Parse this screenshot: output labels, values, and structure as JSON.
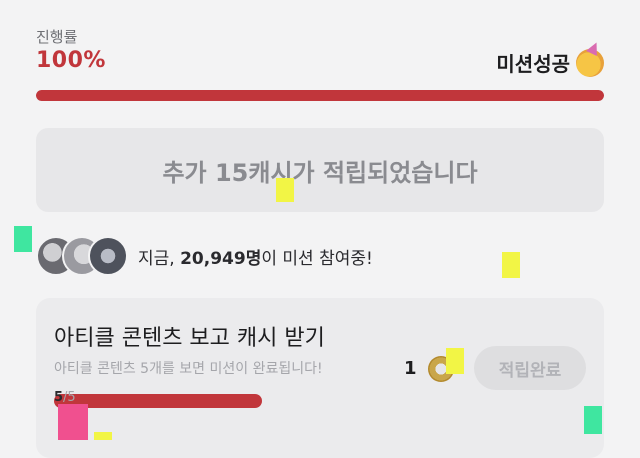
{
  "progress": {
    "label": "진행률",
    "value": "100%",
    "fraction": 1.0,
    "status_text": "미션성공",
    "status_icon": "party-face-icon"
  },
  "reward_banner": {
    "text": "추가 15캐시가 적립되었습니다"
  },
  "participants": {
    "prefix": "지금, ",
    "count": "20,949명",
    "suffix": "이 미션 참여중!",
    "avatars": [
      "avatar-photo-1",
      "avatar-photo-2",
      "avatar-photo-3"
    ]
  },
  "mission": {
    "title": "아티클 콘텐츠 보고 캐시 받기",
    "description": "아티클 콘텐츠 5개를 보면 미션이 완료됩니다!",
    "progress_done": "5",
    "progress_total": "/5",
    "progress_fraction": 1.0,
    "reward_amount": "1",
    "reward_icon": "coin-icon",
    "button_label": "적립완료"
  },
  "colors": {
    "accent": "#c1363b",
    "background": "#f3f3f4",
    "marker_yellow": "#f2f545",
    "marker_green": "#3fe6a0",
    "marker_pink": "#f0508f"
  }
}
